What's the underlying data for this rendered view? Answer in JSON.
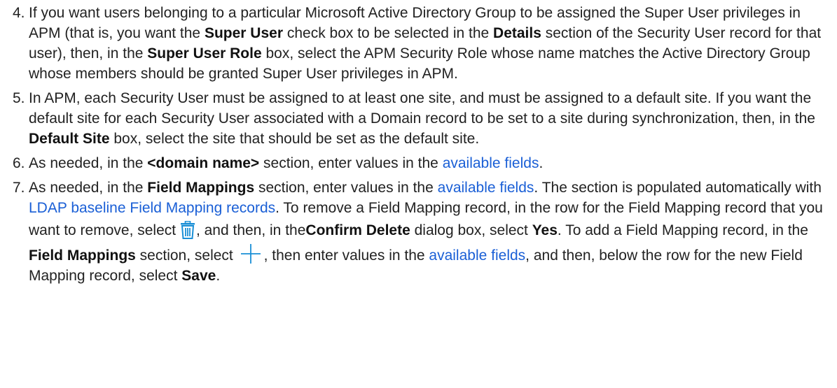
{
  "steps": [
    {
      "number": "4.",
      "t1": "If you want users belonging to a particular Microsoft Active Directory Group to be assigned the Super User privileges in APM (that is, you want the ",
      "b1": "Super User",
      "t2": " check box to be selected in the ",
      "b2": "Details",
      "t3": " section of the Security User record for that user), then, in the ",
      "b3": "Super User Role",
      "t4": " box, select the APM Security Role whose name matches the Active Directory Group whose members should be granted Super User privileges in APM."
    },
    {
      "number": "5.",
      "t1": "In APM, each Security User must be assigned to at least one site, and must be assigned to a default site. If you want the default site for each Security User associated with a Domain record to be set to a site during synchronization, then, in the ",
      "b1": "Default Site",
      "t2": " box, select the site that should be set as the default site."
    },
    {
      "number": "6.",
      "t1": "As needed, in the ",
      "b1": "<domain name>",
      "t2": " section, enter values in the ",
      "link1": "available fields",
      "t3": "."
    },
    {
      "number": "7.",
      "t1": "As needed, in the ",
      "b1": "Field Mappings",
      "t2": " section, enter values in the ",
      "link1": "available fields",
      "t3": ". The section is populated automatically with ",
      "link2": "LDAP baseline Field Mapping records",
      "t4": ". To remove a Field Mapping record, in the row for the Field Mapping record that you want to remove, select ",
      "icon1": "trash-icon",
      "t5": ", and then, in the ",
      "b2": "Confirm Delete",
      "t6": " dialog box, select ",
      "b3": "Yes",
      "t7": ". To add a Field Mapping record, in the ",
      "b4": "Field Mappings",
      "t8": " section, select ",
      "icon2": "plus-icon",
      "t9": ", then enter values in the ",
      "link3": "available fields",
      "t10": ", and then, below the row for the new Field Mapping record, select ",
      "b5": "Save",
      "t11": "."
    }
  ],
  "colors": {
    "link": "#1a5fd6",
    "icon": "#1a8fd6",
    "text": "#222222"
  }
}
